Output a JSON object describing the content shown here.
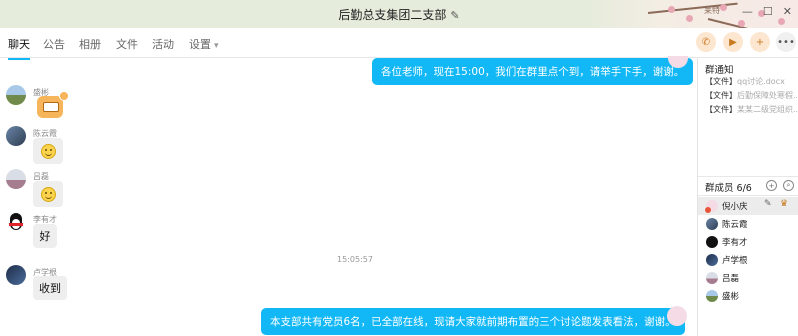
{
  "window": {
    "title": "后勤总支集团二支部",
    "corner_label": "莱特"
  },
  "tabs": [
    {
      "label": "聊天",
      "active": true
    },
    {
      "label": "公告",
      "active": false
    },
    {
      "label": "相册",
      "active": false
    },
    {
      "label": "文件",
      "active": false
    },
    {
      "label": "活动",
      "active": false
    },
    {
      "label": "设置",
      "active": false
    }
  ],
  "colors": {
    "accent": "#12b7f5",
    "title_bg": "#e6ecdc",
    "incoming_bubble": "#eeeeee"
  },
  "chat": {
    "messages": [
      {
        "direction": "outgoing",
        "text": "各位老师，现在15:00，我们在群里点个到，请举手下手，谢谢。"
      },
      {
        "direction": "incoming",
        "sender": "盛彬",
        "content": "grinning-sticker"
      },
      {
        "direction": "incoming",
        "sender": "陈云霞",
        "content": "smile-emoji"
      },
      {
        "direction": "incoming",
        "sender": "吕磊",
        "content": "smile-emoji"
      },
      {
        "direction": "incoming",
        "sender": "李有才",
        "text": "好"
      },
      {
        "direction": "incoming",
        "sender": "卢学根",
        "text": "收到"
      },
      {
        "direction": "outgoing",
        "text": "本支部共有党员6名，已全部在线，现请大家就前期布置的三个讨论题发表看法，谢谢。"
      }
    ],
    "timestamp": "15:05:57"
  },
  "side": {
    "notice_title": "群通知",
    "notices": [
      {
        "tag": "【文件】",
        "name": "qq讨论.docx"
      },
      {
        "tag": "【文件】",
        "name": "后勤保障处寒假..."
      },
      {
        "tag": "【文件】",
        "name": "某某二级党组织..."
      }
    ],
    "members_title": "群成员 6/6",
    "members": [
      {
        "name": "倪小庆",
        "selected": true
      },
      {
        "name": "陈云霞",
        "selected": false
      },
      {
        "name": "李有才",
        "selected": false
      },
      {
        "name": "卢学根",
        "selected": false
      },
      {
        "name": "吕磊",
        "selected": false
      },
      {
        "name": "盛彬",
        "selected": false
      }
    ]
  }
}
